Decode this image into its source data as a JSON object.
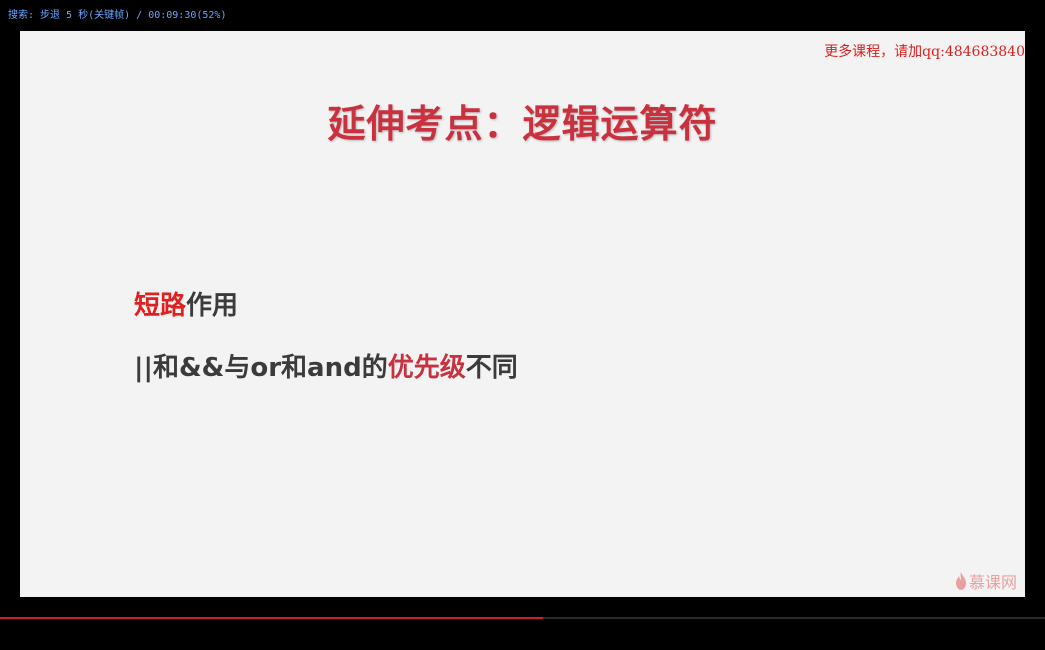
{
  "player": {
    "osd_text": "搜索: 步退 5 秒(关键帧) / 00:09:30(52%)",
    "progress_percent": 52
  },
  "slide": {
    "watermark": "更多课程，请加qq:484683840",
    "title": "延伸考点：逻辑运算符",
    "bullet1": {
      "highlight": "短路",
      "rest": "作用"
    },
    "bullet2": {
      "prefix": "||和&&与or和and的",
      "highlight": "优先级",
      "suffix": "不同"
    },
    "logo_text": "慕课网"
  },
  "colors": {
    "title": "#c9313f",
    "highlight_red": "#e02020",
    "progress": "#d11f1f"
  }
}
